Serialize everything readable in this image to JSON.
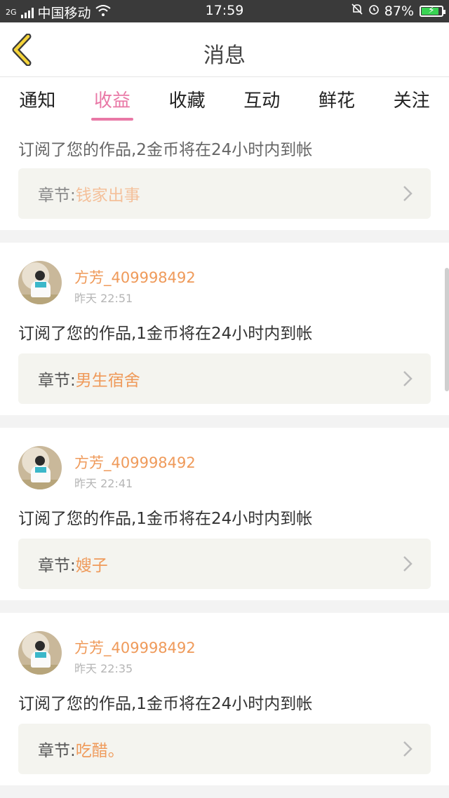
{
  "statusbar": {
    "network_type": "2G",
    "carrier": "中国移动",
    "time": "17:59",
    "battery": "87%",
    "battery_level": 0.87
  },
  "nav": {
    "title": "消息"
  },
  "tabs": [
    "通知",
    "收益",
    "收藏",
    "互动",
    "鲜花",
    "关注"
  ],
  "active_tab": "收益",
  "first_card": {
    "message": "订阅了您的作品,2金币将在24小时内到帐",
    "chapter_label": "章节:",
    "chapter_value": "钱家出事"
  },
  "cards": [
    {
      "username": "方芳_409998492",
      "time": "昨天 22:51",
      "message": "订阅了您的作品,1金币将在24小时内到帐",
      "chapter_label": "章节:",
      "chapter_value": "男生宿舍"
    },
    {
      "username": "方芳_409998492",
      "time": "昨天 22:41",
      "message": "订阅了您的作品,1金币将在24小时内到帐",
      "chapter_label": "章节:",
      "chapter_value": "嫂子"
    },
    {
      "username": "方芳_409998492",
      "time": "昨天 22:35",
      "message": "订阅了您的作品,1金币将在24小时内到帐",
      "chapter_label": "章节:",
      "chapter_value": "吃醋。"
    }
  ],
  "colors": {
    "accent_pink": "#e978a6",
    "accent_orange": "#ef9a5a",
    "status_bar": "#3a3a3a"
  }
}
